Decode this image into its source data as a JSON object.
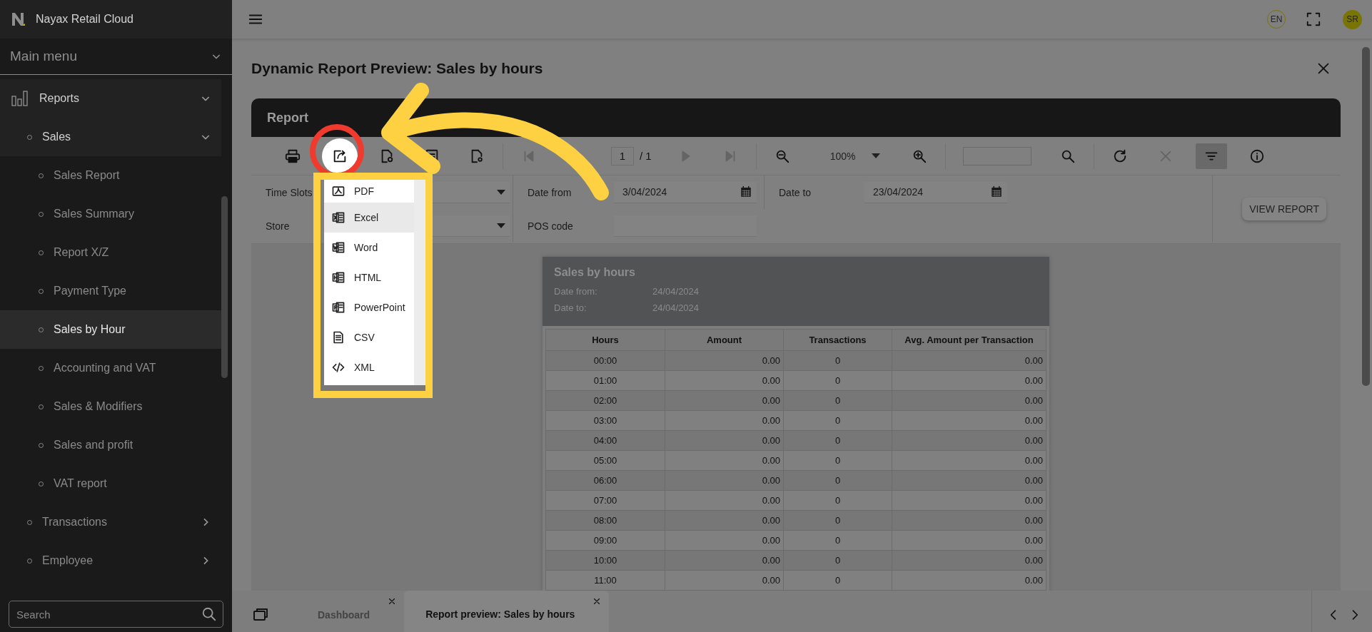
{
  "sidebar": {
    "brand": "Nayax Retail Cloud",
    "menu_title": "Main menu",
    "items": [
      {
        "label": "Reports",
        "expanded": true,
        "selected": false,
        "children": [
          {
            "label": "Sales",
            "expanded": true,
            "selected": false,
            "children": [
              {
                "label": "Sales Report",
                "selected": false
              },
              {
                "label": "Sales Summary",
                "selected": false
              },
              {
                "label": "Report X/Z",
                "selected": false
              },
              {
                "label": "Payment Type",
                "selected": false
              },
              {
                "label": "Sales by Hour",
                "selected": true
              },
              {
                "label": "Accounting and VAT",
                "selected": false
              },
              {
                "label": "Sales & Modifiers",
                "selected": false
              },
              {
                "label": "Sales and profit",
                "selected": false
              },
              {
                "label": "VAT report",
                "selected": false
              }
            ]
          },
          {
            "label": "Transactions",
            "expanded": false,
            "selected": false
          },
          {
            "label": "Employee",
            "expanded": false,
            "selected": false
          }
        ]
      }
    ],
    "search": {
      "placeholder": "Search"
    }
  },
  "header": {
    "language": "EN",
    "avatar": "SR"
  },
  "dialog": {
    "title": "Dynamic Report Preview: Sales by hours",
    "panel_title": "Report",
    "toolbar": {
      "groups": [
        [
          {
            "kind": "print",
            "disabled": false,
            "active": false,
            "highlighted": false
          },
          {
            "kind": "export",
            "disabled": false,
            "active": false,
            "highlighted": true
          },
          {
            "kind": "design",
            "disabled": false,
            "active": false,
            "highlighted": false
          },
          {
            "kind": "document",
            "disabled": false,
            "active": false,
            "highlighted": false
          },
          {
            "kind": "settings",
            "disabled": false,
            "active": false,
            "highlighted": false
          }
        ],
        [
          {
            "kind": "first",
            "disabled": true,
            "active": false,
            "highlighted": false
          },
          {
            "kind": "page_field",
            "value": "1"
          },
          {
            "kind": "page_count",
            "text": "/ 1"
          },
          {
            "kind": "next",
            "disabled": true,
            "active": false,
            "highlighted": false
          },
          {
            "kind": "last",
            "disabled": true,
            "active": false,
            "highlighted": false
          }
        ],
        [
          {
            "kind": "zoom_out",
            "disabled": false,
            "active": false,
            "highlighted": false
          },
          {
            "kind": "zoom_select",
            "value": "100%"
          },
          {
            "kind": "zoom_in",
            "disabled": false,
            "active": false,
            "highlighted": false
          }
        ],
        [
          {
            "kind": "search_field"
          },
          {
            "kind": "search",
            "disabled": false,
            "active": false,
            "highlighted": false
          }
        ],
        [
          {
            "kind": "refresh",
            "disabled": false,
            "active": false,
            "highlighted": false
          },
          {
            "kind": "clear",
            "disabled": true,
            "active": false,
            "highlighted": false
          },
          {
            "kind": "filter",
            "disabled": false,
            "active": true,
            "highlighted": false
          },
          {
            "kind": "info",
            "disabled": false,
            "active": false,
            "highlighted": false
          }
        ]
      ]
    },
    "export_menu": [
      {
        "label": "PDF",
        "kind": "pdf",
        "selected": false
      },
      {
        "label": "Excel",
        "kind": "excel",
        "selected": true
      },
      {
        "label": "Word",
        "kind": "word",
        "selected": false
      },
      {
        "label": "HTML",
        "kind": "html",
        "selected": false
      },
      {
        "label": "PowerPoint",
        "kind": "powerpoint",
        "selected": false
      },
      {
        "label": "CSV",
        "kind": "csv",
        "selected": false
      },
      {
        "label": "XML",
        "kind": "xml",
        "selected": false
      }
    ],
    "filters": [
      {
        "label": "Time Slots",
        "kind": "select"
      },
      {
        "label": "Date from",
        "kind": "date",
        "value": "3/04/2024"
      },
      {
        "label": "Date to",
        "kind": "date",
        "value": "23/04/2024"
      },
      {
        "label": "Store",
        "kind": "select"
      },
      {
        "label": "POS code",
        "kind": "text"
      }
    ],
    "view_button": "VIEW REPORT",
    "report": {
      "title": "Sales by hours",
      "meta": [
        {
          "label": "Date from:",
          "value": "24/04/2024"
        },
        {
          "label": "Date to:",
          "value": "24/04/2024"
        }
      ],
      "columns": [
        "Hours",
        "Amount",
        "Transactions",
        "Avg. Amount per Transaction"
      ],
      "rows": [
        [
          "00:00",
          "0.00",
          "0",
          "0.00"
        ],
        [
          "01:00",
          "0.00",
          "0",
          "0.00"
        ],
        [
          "02:00",
          "0.00",
          "0",
          "0.00"
        ],
        [
          "03:00",
          "0.00",
          "0",
          "0.00"
        ],
        [
          "04:00",
          "0.00",
          "0",
          "0.00"
        ],
        [
          "05:00",
          "0.00",
          "0",
          "0.00"
        ],
        [
          "06:00",
          "0.00",
          "0",
          "0.00"
        ],
        [
          "07:00",
          "0.00",
          "0",
          "0.00"
        ],
        [
          "08:00",
          "0.00",
          "0",
          "0.00"
        ],
        [
          "09:00",
          "0.00",
          "0",
          "0.00"
        ],
        [
          "10:00",
          "0.00",
          "0",
          "0.00"
        ],
        [
          "11:00",
          "0.00",
          "0",
          "0.00"
        ]
      ]
    }
  },
  "tabs": [
    {
      "label": "Dashboard",
      "selected": false
    },
    {
      "label": "Report preview: Sales by hours",
      "selected": true
    }
  ]
}
